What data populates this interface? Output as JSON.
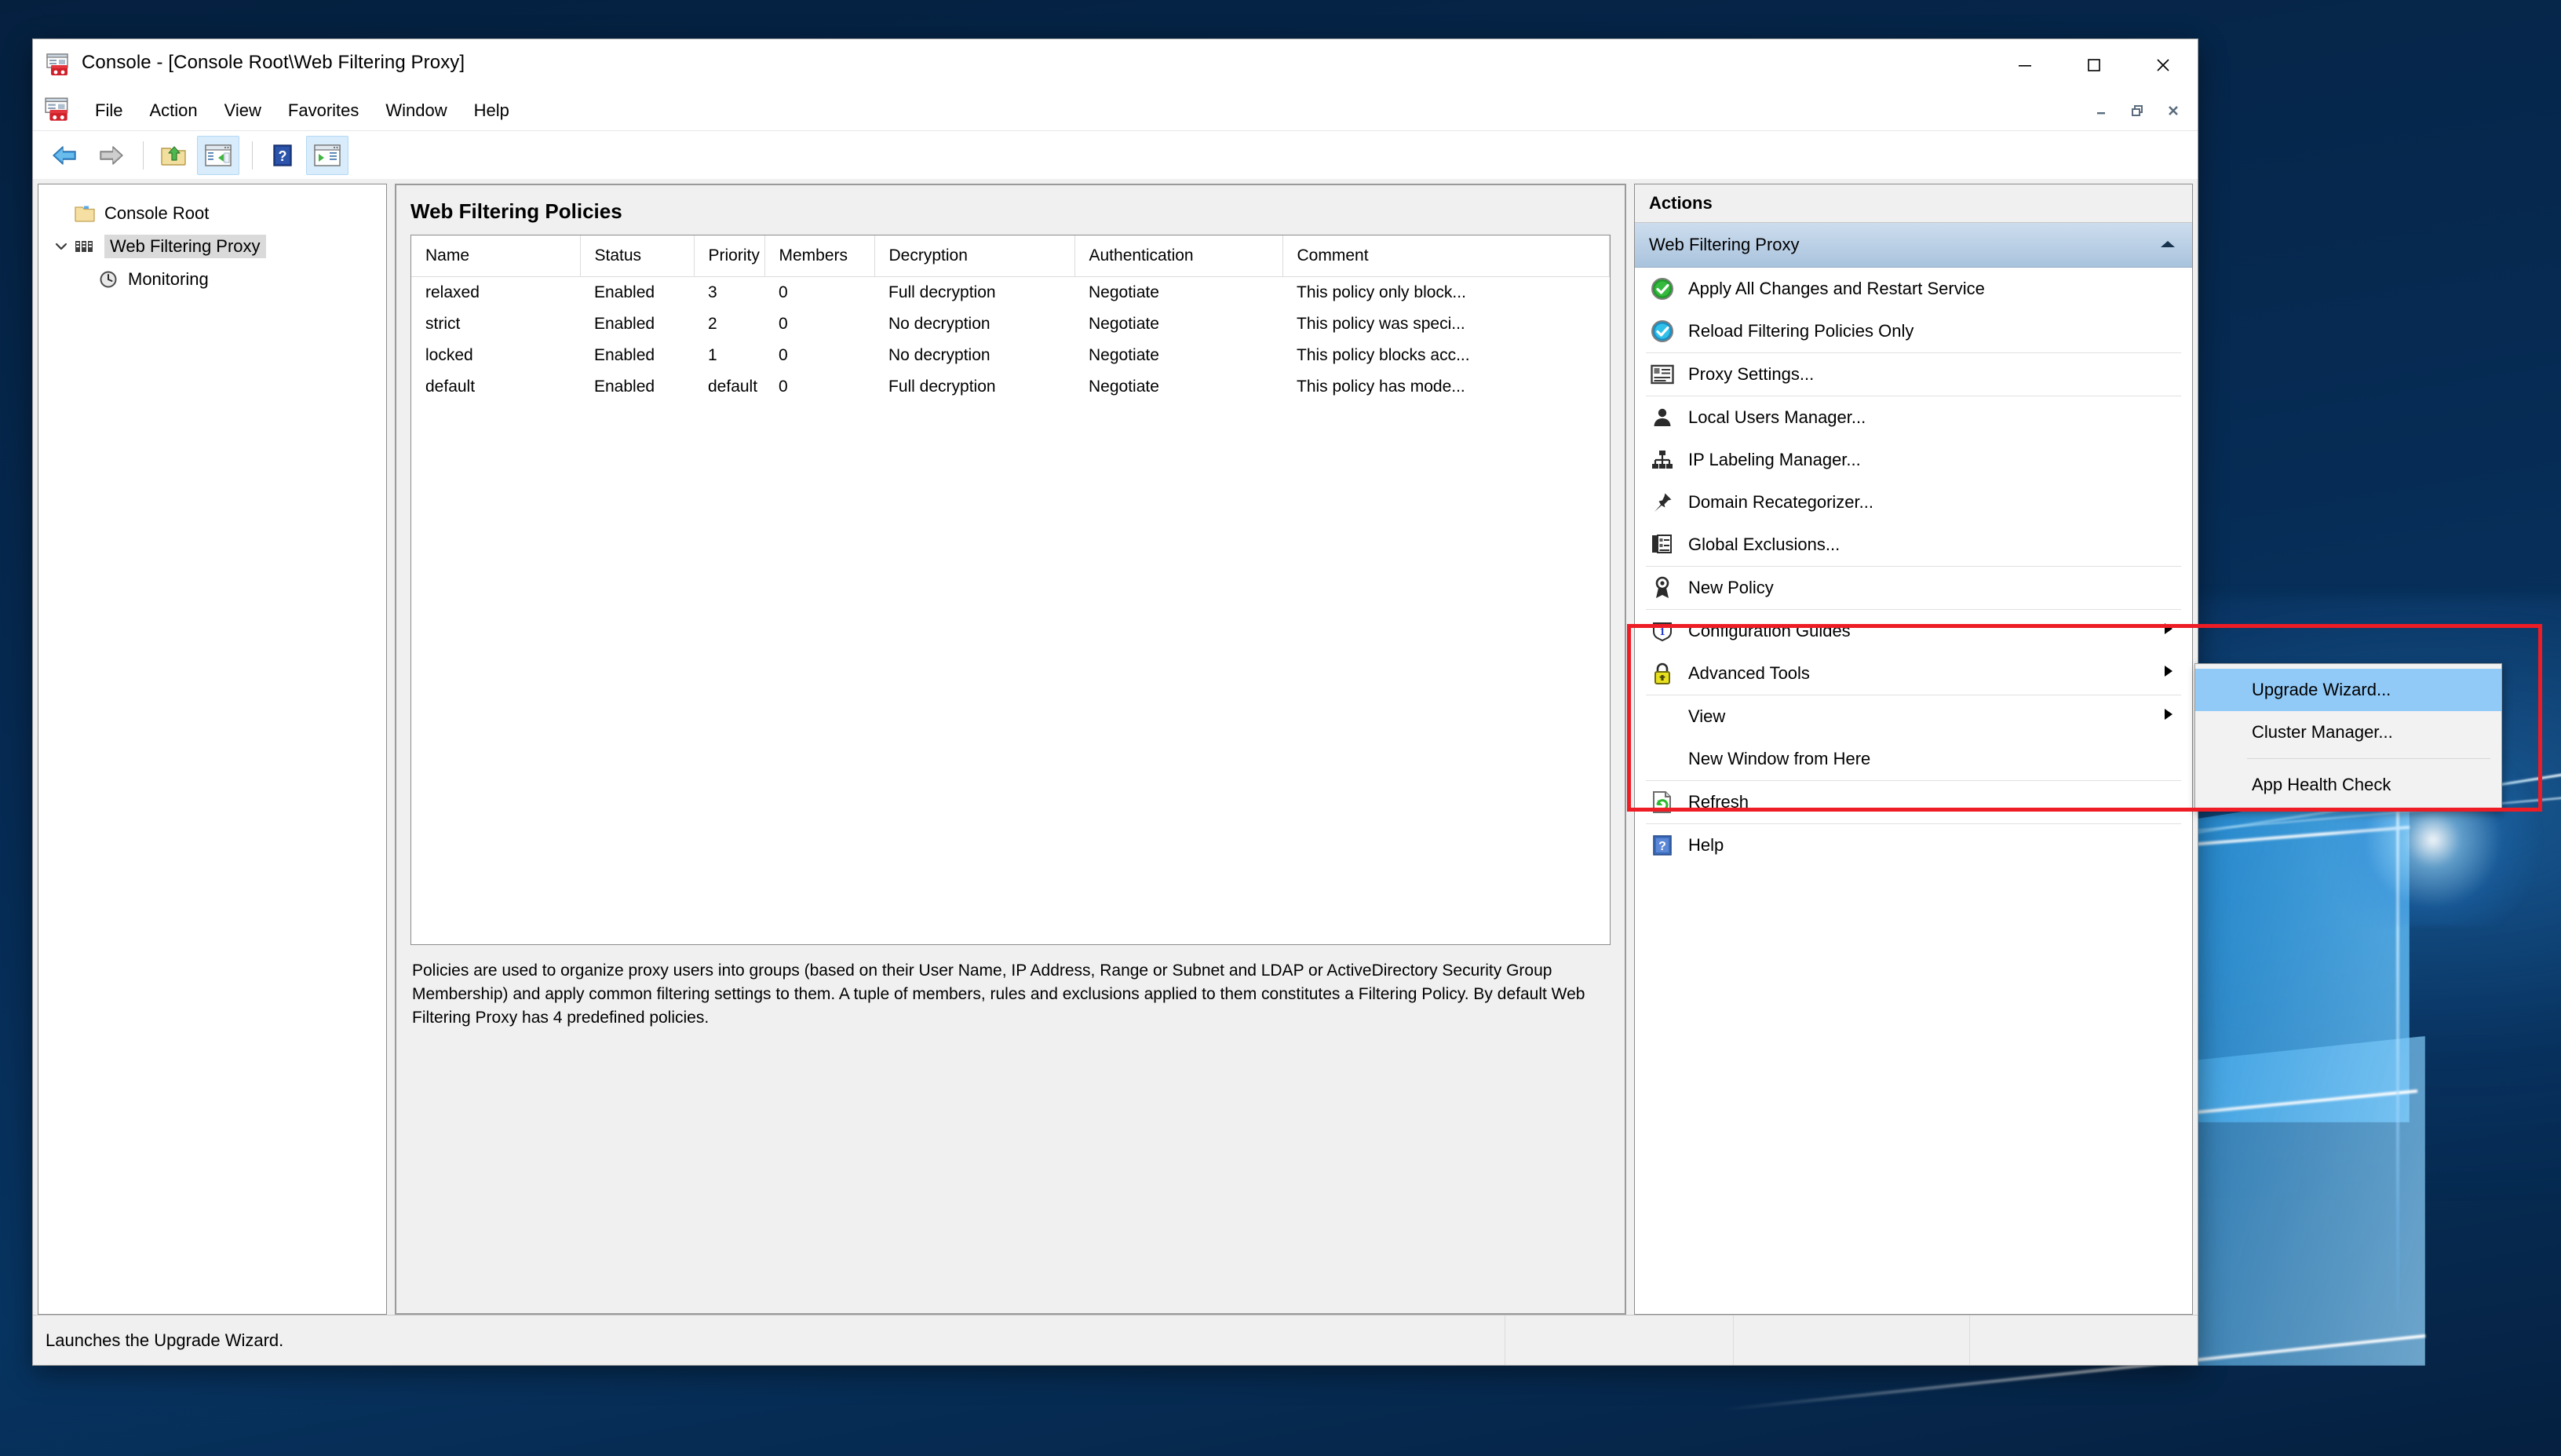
{
  "window": {
    "title": "Console - [Console Root\\Web Filtering Proxy]",
    "app_icon": "mmc-console-icon",
    "minimize_label": "Minimize",
    "maximize_label": "Maximize",
    "close_label": "Close",
    "mdi_minimize_label": "Restore Down Child",
    "mdi_restore_label": "Restore Child",
    "mdi_close_label": "Close Child"
  },
  "menubar": {
    "items": [
      {
        "label": "File"
      },
      {
        "label": "Action"
      },
      {
        "label": "View"
      },
      {
        "label": "Favorites"
      },
      {
        "label": "Window"
      },
      {
        "label": "Help"
      }
    ]
  },
  "toolbar": {
    "buttons": [
      {
        "icon": "back-arrow-icon",
        "name": "back-button",
        "active": false
      },
      {
        "icon": "forward-arrow-icon",
        "name": "forward-button",
        "active": false
      },
      {
        "icon": "up-folder-icon",
        "name": "up-one-level-button",
        "active": false
      },
      {
        "icon": "show-hide-tree-icon",
        "name": "show-hide-console-tree-button",
        "active": true
      },
      {
        "icon": "help-icon",
        "name": "help-button",
        "active": false
      },
      {
        "icon": "show-hide-action-pane-icon",
        "name": "show-hide-action-pane-button",
        "active": true
      }
    ]
  },
  "tree": {
    "nodes": [
      {
        "label": "Console Root",
        "icon": "folder-icon",
        "level": 1,
        "expander": "",
        "selected": false
      },
      {
        "label": "Web Filtering Proxy",
        "icon": "snapin-icon",
        "level": 1,
        "expander": "expanded",
        "selected": true
      },
      {
        "label": "Monitoring",
        "icon": "clock-icon",
        "level": 2,
        "expander": "",
        "selected": false
      }
    ]
  },
  "content": {
    "page_title": "Web Filtering Policies",
    "columns": [
      "Name",
      "Status",
      "Priority",
      "Members",
      "Decryption",
      "Authentication",
      "Comment"
    ],
    "rows": [
      [
        "relaxed",
        "Enabled",
        "3",
        "0",
        "Full decryption",
        "Negotiate",
        "This policy only block..."
      ],
      [
        "strict",
        "Enabled",
        "2",
        "0",
        "No decryption",
        "Negotiate",
        "This policy was speci..."
      ],
      [
        "locked",
        "Enabled",
        "1",
        "0",
        "No decryption",
        "Negotiate",
        "This policy blocks acc..."
      ],
      [
        "default",
        "Enabled",
        "default",
        "0",
        "Full decryption",
        "Negotiate",
        "This policy has mode..."
      ]
    ],
    "description": "Policies are used to organize proxy users into groups (based on their User Name, IP Address, Range or Subnet and LDAP or ActiveDirectory Security Group Membership) and apply common filtering settings to them. A tuple of members, rules and exclusions applied to them constitutes a Filtering Policy. By default Web Filtering Proxy has 4 predefined policies."
  },
  "actions": {
    "header": "Actions",
    "group_title": "Web Filtering Proxy",
    "group_collapse_icon": "chevron-up-icon",
    "items": [
      {
        "label": "Apply All Changes and Restart Service",
        "icon": "green-check-circle-icon",
        "submenu": false,
        "separator_after": false
      },
      {
        "label": "Reload Filtering Policies Only",
        "icon": "blue-check-circle-icon",
        "submenu": false,
        "separator_after": true
      },
      {
        "label": "Proxy Settings...",
        "icon": "properties-icon",
        "submenu": false,
        "separator_after": true
      },
      {
        "label": "Local Users Manager...",
        "icon": "user-icon",
        "submenu": false,
        "separator_after": false
      },
      {
        "label": "IP Labeling Manager...",
        "icon": "network-tree-icon",
        "submenu": false,
        "separator_after": false
      },
      {
        "label": "Domain Recategorizer...",
        "icon": "pushpin-icon",
        "submenu": false,
        "separator_after": false
      },
      {
        "label": "Global Exclusions...",
        "icon": "document-list-icon",
        "submenu": false,
        "separator_after": true
      },
      {
        "label": "New Policy",
        "icon": "ribbon-award-icon",
        "submenu": false,
        "separator_after": true
      },
      {
        "label": "Configuration Guides",
        "icon": "info-badge-icon",
        "submenu": true,
        "separator_after": false
      },
      {
        "label": "Advanced Tools",
        "icon": "yellow-padlock-icon",
        "submenu": true,
        "separator_after": true
      },
      {
        "label": "View",
        "icon": "",
        "submenu": true,
        "separator_after": false
      },
      {
        "label": "New Window from Here",
        "icon": "",
        "submenu": false,
        "separator_after": true
      },
      {
        "label": "Refresh",
        "icon": "refresh-page-icon",
        "submenu": false,
        "separator_after": true
      },
      {
        "label": "Help",
        "icon": "blue-help-icon",
        "submenu": false,
        "separator_after": false
      }
    ]
  },
  "submenu": {
    "parent": "Advanced Tools",
    "items": [
      {
        "label": "Upgrade Wizard...",
        "highlighted": true,
        "separator_after": false
      },
      {
        "label": "Cluster Manager...",
        "highlighted": false,
        "separator_after": true
      },
      {
        "label": "App Health Check",
        "highlighted": false,
        "separator_after": false
      }
    ]
  },
  "statusbar": {
    "text": "Launches the Upgrade Wizard."
  },
  "annotation": {
    "highlight_color": "#ee1c25"
  }
}
